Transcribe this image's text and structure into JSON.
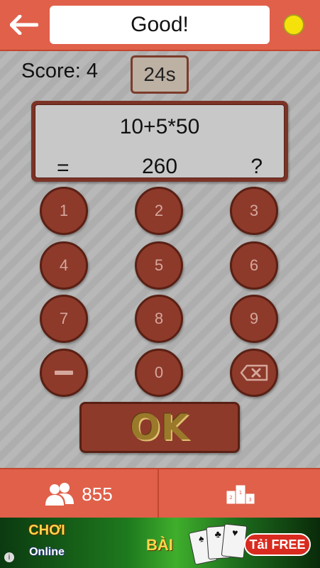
{
  "header": {
    "title": "Good!"
  },
  "game": {
    "score_label": "Score: 4",
    "timer": "24s",
    "expression": "10+5*50",
    "equals_sign": "=",
    "answer": "260",
    "unknown_mark": "?"
  },
  "keypad": {
    "k1": "1",
    "k2": "2",
    "k3": "3",
    "k4": "4",
    "k5": "5",
    "k6": "6",
    "k7": "7",
    "k8": "8",
    "k9": "9",
    "k0": "0",
    "ok": "OK"
  },
  "footer": {
    "players_count": "855",
    "leaderboard_icon": "podium-icon"
  },
  "ad": {
    "brand_line1": "CHƠI",
    "brand_line2": "Online",
    "middle_text": "BÀI",
    "cta": "Tải FREE",
    "info_icon": "info-icon"
  },
  "colors": {
    "topbar": "#e0604a",
    "key": "#8d3a2b",
    "key_border": "#5a2014",
    "status_dot": "#f5e20a"
  }
}
